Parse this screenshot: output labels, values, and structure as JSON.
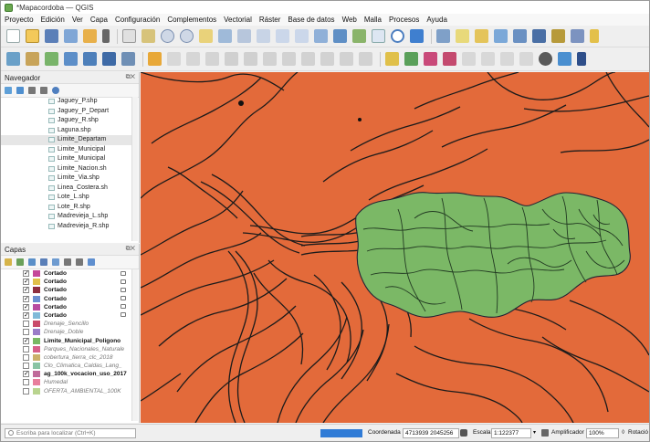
{
  "window": {
    "title": "*Mapacordoba — QGIS"
  },
  "menu": [
    "Proyecto",
    "Edición",
    "Ver",
    "Capa",
    "Configuración",
    "Complementos",
    "Vectorial",
    "Ráster",
    "Base de datos",
    "Web",
    "Malla",
    "Procesos",
    "Ayuda"
  ],
  "navigator": {
    "title": "Navegador",
    "items": [
      "Jaguey_P.shp",
      "Jaguey_P_Depart",
      "Jaguey_R.shp",
      "Laguna.shp",
      "Limite_Departam",
      "Limite_Municipal",
      "Limite_Municipal",
      "Limite_Nacion.sh",
      "Limite_Via.shp",
      "Linea_Costera.sh",
      "Lote_L.shp",
      "Lote_R.shp",
      "Madrevieja_L.shp",
      "Madrevieja_R.shp"
    ],
    "selected_index": 4
  },
  "layers": {
    "title": "Capas",
    "items": [
      {
        "label": "Cortado",
        "checked": true,
        "color": "#c5479a",
        "style": "bold"
      },
      {
        "label": "Cortado",
        "checked": true,
        "color": "#e0c04a",
        "style": "bold"
      },
      {
        "label": "Cortado",
        "checked": true,
        "color": "#8e2f3f",
        "style": "bold"
      },
      {
        "label": "Cortado",
        "checked": true,
        "color": "#6b8fd0",
        "style": "bold"
      },
      {
        "label": "Cortado",
        "checked": true,
        "color": "#b84aa0",
        "style": "bold"
      },
      {
        "label": "Cortado",
        "checked": true,
        "color": "#7fb9d8",
        "style": "bold"
      },
      {
        "label": "Drenaje_Sencillo",
        "checked": false,
        "color": "#c94a6a",
        "style": "italic"
      },
      {
        "label": "Drenaje_Doble",
        "checked": false,
        "color": "#9a7cc8",
        "style": "italic"
      },
      {
        "label": "Limite_Municipal_Poligono",
        "checked": true,
        "color": "#78b864",
        "style": "bold"
      },
      {
        "label": "Parques_Nacionales_Naturale",
        "checked": false,
        "color": "#d65f8a",
        "style": "italic"
      },
      {
        "label": "cobertura_tierra_clc_2018",
        "checked": false,
        "color": "#cbb06b",
        "style": "italic"
      },
      {
        "label": "Clo_Climatica_Caldas_Lang_",
        "checked": false,
        "color": "#89c4a4",
        "style": "italic"
      },
      {
        "label": "ag_100k_vocacion_uso_2017",
        "checked": true,
        "color": "#c06b9a",
        "style": "bold"
      },
      {
        "label": "Humedal",
        "checked": false,
        "color": "#e87e9c",
        "style": "italic"
      },
      {
        "label": "OFERTA_AMBIENTAL_100K",
        "checked": false,
        "color": "#b9d48f",
        "style": "italic"
      }
    ]
  },
  "status": {
    "locator_placeholder": "Escriba para localizar (Ctrl+K)",
    "coord_label": "Coordenada",
    "coord_value": "4713939 2045256",
    "scale_label": "Escala",
    "scale_value": "1:122377",
    "magnifier_label": "Amplificador",
    "magnifier_value": "100%",
    "rotation_label": "Rotació"
  },
  "colors": {
    "map_background": "#e36a3a",
    "polygon_fill": "#7bb866"
  }
}
